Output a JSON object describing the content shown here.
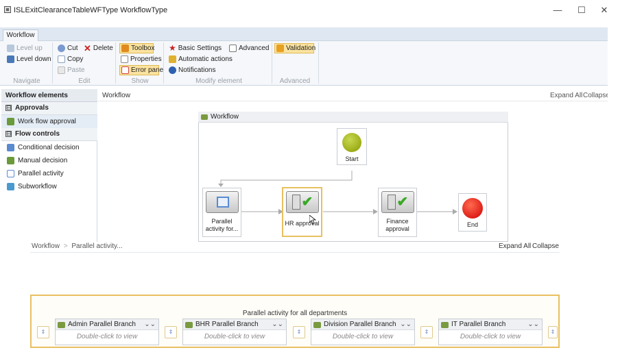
{
  "window": {
    "title": "ISLExitClearanceTableWFType WorkflowType",
    "minimize": "—",
    "maximize": "☐",
    "close": "✕"
  },
  "ribbon": {
    "tab": "Workflow",
    "navigate": {
      "level_up": "Level up",
      "level_down": "Level down",
      "label": "Navigate"
    },
    "edit": {
      "cut": "Cut",
      "copy": "Copy",
      "paste": "Paste",
      "delete": "Delete",
      "label": "Edit"
    },
    "show": {
      "toolbox": "Toolbox",
      "properties": "Properties",
      "error_pane": "Error pane",
      "label": "Show"
    },
    "modify": {
      "basic_settings": "Basic Settings",
      "advanced": "Advanced",
      "automatic_actions": "Automatic actions",
      "notifications": "Notifications",
      "label": "Modify element"
    },
    "advanced": {
      "validation": "Validation",
      "label": "Advanced"
    }
  },
  "toolbox": {
    "header": "Workflow elements",
    "sections": [
      {
        "title": "Approvals",
        "toggle": "⊟",
        "items": [
          "Work flow approval"
        ]
      },
      {
        "title": "Flow controls",
        "toggle": "⊟",
        "items": [
          "Conditional decision",
          "Manual decision",
          "Parallel activity",
          "Subworkflow"
        ]
      }
    ]
  },
  "canvas": {
    "breadcrumb": "Workflow",
    "expand_all": "Expand All",
    "collapse": "Collapse A",
    "frame_title": "Workflow",
    "nodes": {
      "start": "Start",
      "parallel": "Parallel activity for...",
      "hr": "HR approval",
      "finance": "Finance approval",
      "end": "End"
    }
  },
  "bottom": {
    "breadcrumb": [
      "Workflow",
      "Parallel activity..."
    ],
    "separator": ">",
    "expand_all": "Expand All",
    "collapse": "Collapse",
    "parallel_title": "Parallel activity for all departments",
    "branches": [
      {
        "name": "Admin Parallel Branch",
        "hint": "Double-click to view"
      },
      {
        "name": "BHR Parallel Branch",
        "hint": "Double-click to view"
      },
      {
        "name": "Division Parallel Branch",
        "hint": "Double-click to view"
      },
      {
        "name": "IT Parallel Branch",
        "hint": "Double-click to view"
      }
    ]
  },
  "colors": {
    "highlight": "#fbe3a0",
    "start": "#9aa800",
    "end": "#e81010",
    "check": "#3aa828"
  }
}
